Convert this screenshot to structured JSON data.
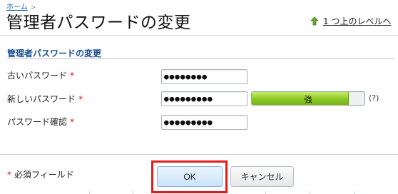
{
  "breadcrumb": {
    "home": "ホーム",
    "separator": ">"
  },
  "page": {
    "title": "管理者パスワードの変更"
  },
  "up_link": {
    "label": "1 つ上のレベルへ",
    "icon": "arrow-up-icon",
    "icon_color": "#5a9a2a"
  },
  "section": {
    "title": "管理者パスワードの変更"
  },
  "form": {
    "required_mark": "*",
    "old_password": {
      "label": "古いパスワード",
      "value": "●●●●●●●●"
    },
    "new_password": {
      "label": "新しいパスワード",
      "value": "●●●●●●●●●"
    },
    "confirm_password": {
      "label": "パスワード確認",
      "value": "●●●●●●●●●"
    },
    "strength": {
      "label": "強",
      "level": 0.86,
      "help": "(?)"
    }
  },
  "footer": {
    "required_note": "必須フィールド",
    "ok_label": "OK",
    "cancel_label": "キャンセル"
  },
  "colors": {
    "accent": "#1a4f91",
    "required": "#d0171a",
    "highlight": "#e21b1b"
  }
}
